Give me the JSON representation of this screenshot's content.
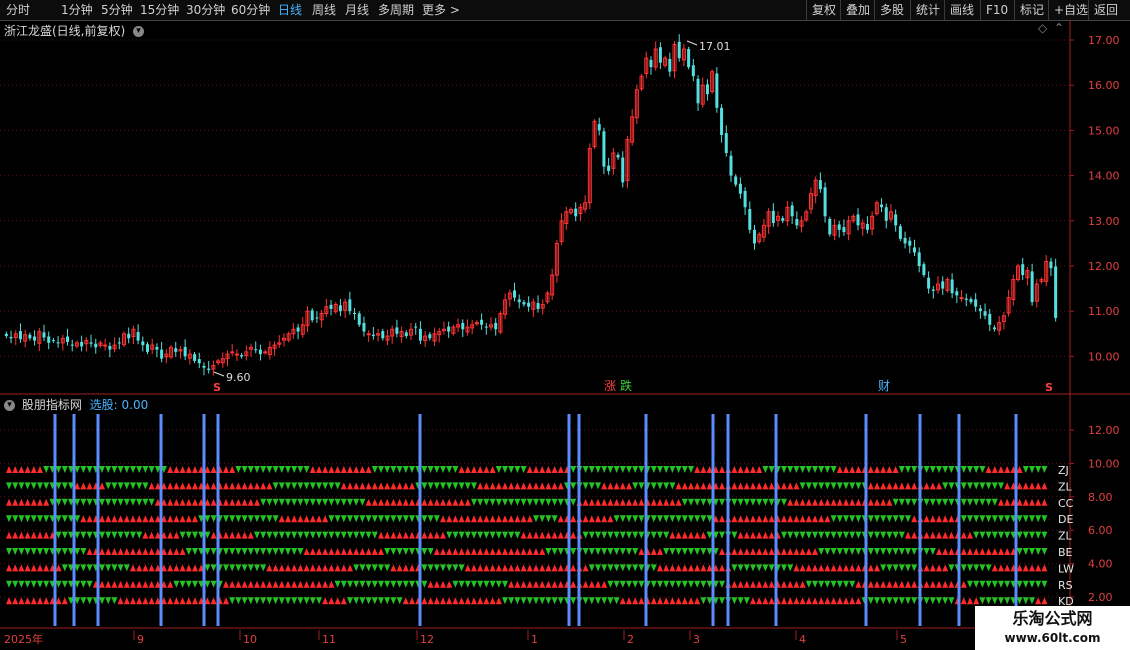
{
  "toolbar": {
    "left": [
      "分时",
      "1分钟",
      "5分钟",
      "15分钟",
      "30分钟",
      "60分钟",
      "日线",
      "周线",
      "月线",
      "多周期",
      "更多 >"
    ],
    "active_index": 6,
    "right": [
      "复权",
      "叠加",
      "多股",
      "统计",
      "画线",
      "F10",
      "标记",
      "+自选",
      "返回"
    ]
  },
  "main": {
    "title": "浙江龙盛(日线,前复权)",
    "price_ticks": [
      "17.00",
      "16.00",
      "15.00",
      "14.00",
      "13.00",
      "12.00",
      "11.00",
      "10.00"
    ],
    "high_label": "17.01",
    "low_label": "9.60",
    "zhang_label": "涨",
    "die_label": "跌",
    "cai_label": "财",
    "s_mark": "S"
  },
  "indicator": {
    "name": "股朋指标网",
    "select_label": "选股:",
    "select_value": "0.00",
    "ticks": [
      "12.00",
      "10.00",
      "8.00",
      "6.00",
      "4.00",
      "2.00"
    ],
    "row_labels": [
      "ZJ",
      "ZL",
      "CC",
      "DE",
      "ZL",
      "BE",
      "LW",
      "RS",
      "KD"
    ]
  },
  "dates": {
    "year_label": "2025年",
    "months": [
      "9",
      "10",
      "11",
      "12",
      "1",
      "2",
      "3",
      "4",
      "5"
    ]
  },
  "watermark": {
    "title": "乐淘公式网",
    "url": "www.60lt.com"
  },
  "colors": {
    "up": "#ff2a2a",
    "down": "#26c126",
    "up_candle": "#ff3333",
    "down_candle": "#55e0e0",
    "signal": "#5b8dff",
    "grid": "#5a1010",
    "axis": "#a02020"
  },
  "chart_data": {
    "type": "candlestick",
    "closes": [
      10.45,
      10.4,
      10.5,
      10.38,
      10.48,
      10.4,
      10.35,
      10.55,
      10.42,
      10.3,
      10.35,
      10.3,
      10.4,
      10.32,
      10.25,
      10.3,
      10.22,
      10.35,
      10.28,
      10.2,
      10.3,
      10.25,
      10.15,
      10.25,
      10.3,
      10.5,
      10.4,
      10.6,
      10.35,
      10.25,
      10.1,
      10.25,
      10.15,
      9.95,
      10.05,
      10.2,
      10.1,
      10.15,
      10.0,
      10.05,
      9.9,
      9.85,
      9.75,
      9.7,
      9.8,
      9.9,
      9.95,
      10.05,
      10.1,
      10.05,
      10.0,
      10.1,
      10.2,
      10.15,
      10.05,
      10.1,
      10.2,
      10.25,
      10.3,
      10.4,
      10.5,
      10.6,
      10.55,
      10.7,
      11.0,
      10.8,
      10.85,
      10.95,
      11.1,
      11.05,
      11.15,
      11.0,
      11.2,
      11.0,
      10.95,
      10.7,
      10.55,
      10.5,
      10.45,
      10.5,
      10.4,
      10.45,
      10.6,
      10.5,
      10.55,
      10.45,
      10.6,
      10.65,
      10.35,
      10.45,
      10.4,
      10.5,
      10.55,
      10.6,
      10.55,
      10.65,
      10.7,
      10.6,
      10.65,
      10.7,
      10.75,
      10.7,
      10.65,
      10.7,
      10.6,
      10.95,
      11.25,
      11.4,
      11.3,
      11.2,
      11.15,
      11.1,
      11.2,
      11.05,
      11.15,
      11.4,
      11.8,
      12.5,
      13.0,
      13.2,
      13.25,
      13.1,
      13.3,
      13.4,
      14.6,
      15.2,
      15.0,
      14.2,
      14.1,
      14.5,
      14.4,
      13.85,
      14.8,
      15.3,
      15.9,
      16.2,
      16.6,
      16.4,
      16.8,
      16.5,
      16.6,
      16.3,
      16.9,
      16.6,
      16.8,
      16.4,
      16.2,
      15.6,
      16.0,
      15.8,
      16.3,
      15.5,
      14.9,
      14.5,
      14.0,
      13.8,
      13.6,
      13.3,
      12.8,
      12.5,
      12.7,
      12.9,
      13.2,
      12.95,
      13.1,
      13.0,
      13.3,
      13.1,
      12.9,
      13.0,
      13.2,
      13.6,
      13.9,
      13.7,
      13.1,
      12.7,
      12.9,
      12.8,
      12.75,
      13.0,
      13.1,
      12.9,
      12.95,
      12.8,
      13.1,
      13.4,
      13.3,
      13.0,
      13.2,
      12.9,
      12.6,
      12.5,
      12.45,
      12.3,
      12.0,
      11.8,
      11.5,
      11.45,
      11.6,
      11.5,
      11.7,
      11.4,
      11.35,
      11.3,
      11.25,
      11.2,
      11.1,
      11.0,
      10.9,
      10.7,
      10.6,
      10.75,
      10.9,
      11.3,
      11.7,
      12.0,
      11.8,
      11.9,
      11.2,
      11.6,
      11.7,
      12.1,
      11.95,
      10.85
    ]
  }
}
